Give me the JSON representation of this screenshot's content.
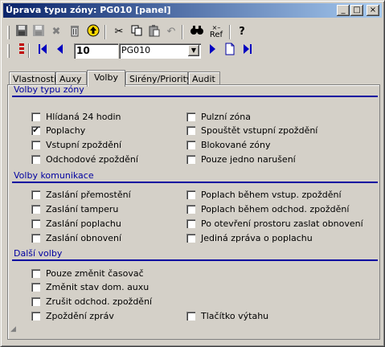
{
  "window": {
    "title": "Úprava typu zóny: PG010 [panel]",
    "controls": {
      "minimize": "_",
      "maximize": "□",
      "close": "×"
    }
  },
  "toolbar1": {
    "icons": [
      "save-icon",
      "save-disabled-icon",
      "delete-icon",
      "trash-icon",
      "up-icon",
      "cut-icon",
      "copy-icon",
      "paste-icon",
      "undo-icon",
      "find-icon",
      "ref-icon",
      "help-icon"
    ],
    "ref_label": "Ref"
  },
  "toolbar2": {
    "record_number": "10",
    "combo_value": "PG010"
  },
  "tabs": [
    {
      "label": "Vlastnosti"
    },
    {
      "label": "Auxy"
    },
    {
      "label": "Volby"
    },
    {
      "label": "Sirény/Priority"
    },
    {
      "label": "Audit"
    }
  ],
  "active_tab": "Volby",
  "sections": {
    "zone_type": {
      "title": "Volby typu zóny",
      "left": [
        {
          "label": "Hlídaná 24 hodin",
          "checked": false
        },
        {
          "label": "Poplachy",
          "checked": true
        },
        {
          "label": "Vstupní zpoždění",
          "checked": false
        },
        {
          "label": "Odchodové zpoždění",
          "checked": false
        }
      ],
      "right": [
        {
          "label": "Pulzní zóna",
          "checked": false
        },
        {
          "label": "Spouštět vstupní zpoždění",
          "checked": false
        },
        {
          "label": "Blokované zóny",
          "checked": false
        },
        {
          "label": "Pouze jedno narušení",
          "checked": false
        }
      ]
    },
    "communication": {
      "title": "Volby komunikace",
      "left": [
        {
          "label": "Zaslání přemostění",
          "checked": false
        },
        {
          "label": "Zaslání tamperu",
          "checked": false
        },
        {
          "label": "Zaslání poplachu",
          "checked": false
        },
        {
          "label": "Zaslání obnovení",
          "checked": false
        }
      ],
      "right": [
        {
          "label": "Poplach během vstup. zpoždění",
          "checked": false
        },
        {
          "label": "Poplach během odchod. zpoždění",
          "checked": false
        },
        {
          "label": "Po otevření prostoru zaslat obnovení",
          "checked": false
        },
        {
          "label": "Jediná zpráva o poplachu",
          "checked": false
        }
      ]
    },
    "other": {
      "title": "Další volby",
      "left": [
        {
          "label": "Pouze změnit časovač",
          "checked": false
        },
        {
          "label": "Změnit stav dom. auxu",
          "checked": false
        },
        {
          "label": "Zrušit odchod. zpoždění",
          "checked": false
        },
        {
          "label": "Zpoždění zpráv",
          "checked": false
        }
      ],
      "right": [
        {
          "label": "Tlačítko výtahu",
          "checked": false
        }
      ]
    }
  }
}
